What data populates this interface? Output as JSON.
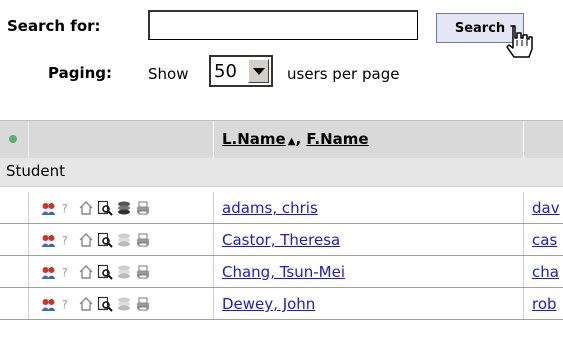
{
  "search": {
    "label": "Search for:",
    "value": "",
    "button_label": "Search"
  },
  "paging": {
    "label": "Paging:",
    "show_text": "Show",
    "per_page": "50",
    "suffix": "users per page"
  },
  "table": {
    "header_lname": "L.Name",
    "sort_arrow": "▲",
    "header_comma": ", ",
    "header_fname": "F.Name",
    "group": "Student",
    "rows": [
      {
        "name": "adams, chris",
        "email": "dav"
      },
      {
        "name": "Castor, Theresa",
        "email": "cas"
      },
      {
        "name": "Chang, Tsun-Mei",
        "email": "cha"
      },
      {
        "name": "Dewey, John",
        "email": "rob"
      }
    ]
  },
  "row_icons": [
    "group-users-icon",
    "help-icon",
    "home-icon",
    "magnifier-doc-icon",
    "stack-icon",
    "printer-icon"
  ],
  "colors": {
    "link": "#1a1ad8",
    "header_bg": "#d9d9d9",
    "status_dot": "#5ab56a",
    "button_bg": "#e4e6f5"
  }
}
